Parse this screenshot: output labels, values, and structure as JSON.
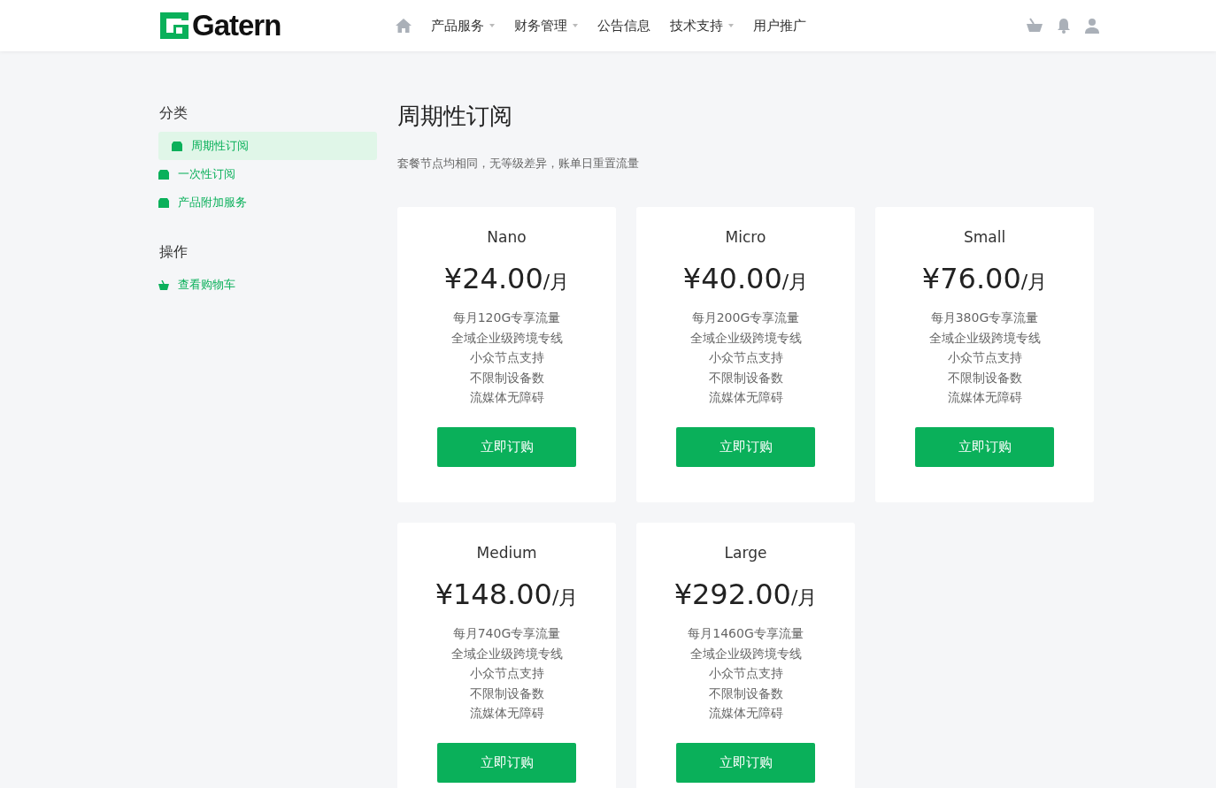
{
  "header": {
    "logo": "Gatern",
    "nav": [
      {
        "label": "产品服务",
        "dropdown": true
      },
      {
        "label": "财务管理",
        "dropdown": true
      },
      {
        "label": "公告信息",
        "dropdown": false
      },
      {
        "label": "技术支持",
        "dropdown": true
      },
      {
        "label": "用户推广",
        "dropdown": false
      }
    ]
  },
  "sidebar": {
    "sections": [
      {
        "title": "分类",
        "items": [
          {
            "label": "周期性订阅",
            "kind": "category",
            "selected": true
          },
          {
            "label": "一次性订阅",
            "kind": "category",
            "selected": false
          },
          {
            "label": "产品附加服务",
            "kind": "category",
            "selected": false
          }
        ]
      },
      {
        "title": "操作",
        "items": [
          {
            "label": "查看购物车",
            "kind": "cart",
            "selected": false
          }
        ]
      }
    ]
  },
  "main": {
    "title": "周期性订阅",
    "description": "套餐节点均相同，无等级差异，账单日重置流量",
    "plans": [
      {
        "name": "Nano",
        "price": "¥24.00",
        "unit": "/月",
        "features": [
          "每月120G专享流量",
          "全域企业级跨境专线",
          "小众节点支持",
          "不限制设备数",
          "流媒体无障碍"
        ],
        "button": "立即订购"
      },
      {
        "name": "Micro",
        "price": "¥40.00",
        "unit": "/月",
        "features": [
          "每月200G专享流量",
          "全域企业级跨境专线",
          "小众节点支持",
          "不限制设备数",
          "流媒体无障碍"
        ],
        "button": "立即订购"
      },
      {
        "name": "Small",
        "price": "¥76.00",
        "unit": "/月",
        "features": [
          "每月380G专享流量",
          "全域企业级跨境专线",
          "小众节点支持",
          "不限制设备数",
          "流媒体无障碍"
        ],
        "button": "立即订购"
      },
      {
        "name": "Medium",
        "price": "¥148.00",
        "unit": "/月",
        "features": [
          "每月740G专享流量",
          "全域企业级跨境专线",
          "小众节点支持",
          "不限制设备数",
          "流媒体无障碍"
        ],
        "button": "立即订购"
      },
      {
        "name": "Large",
        "price": "¥292.00",
        "unit": "/月",
        "features": [
          "每月1460G专享流量",
          "全域企业级跨境专线",
          "小众节点支持",
          "不限制设备数",
          "流媒体无障碍"
        ],
        "button": "立即订购"
      }
    ]
  }
}
